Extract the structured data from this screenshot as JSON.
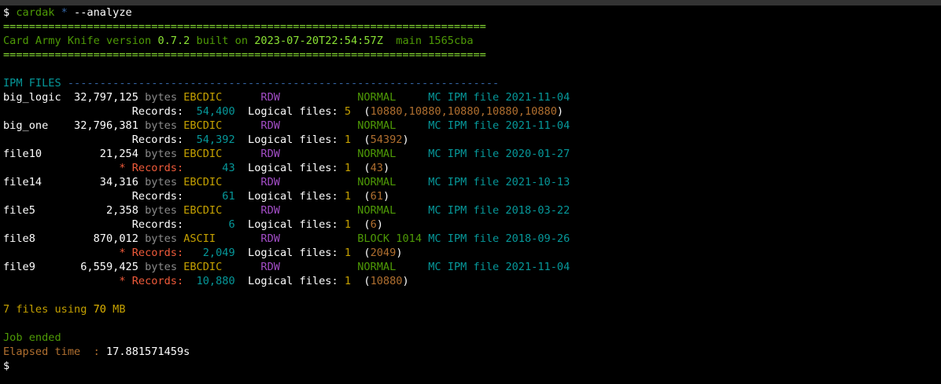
{
  "prompt": {
    "sign": "$",
    "command": "cardak",
    "glob": "*",
    "flag": "--analyze"
  },
  "banner": {
    "rule": "===========================================================================",
    "product": "Card Army Knife",
    "version_label": "version",
    "version": "0.7.2",
    "built_label": "built on",
    "built": "2023-07-20T22:54:57Z",
    "branch": "main",
    "commit": "1565cba"
  },
  "section": {
    "title": "IPM FILES",
    "rule": "-------------------------------------------------------------------"
  },
  "files": [
    {
      "name": "big_logic",
      "size": "32,797,125",
      "encoding": "EBCDIC",
      "format": "RDW",
      "blocking": "NORMAL",
      "type": "MC IPM file",
      "date": "2021-11-04",
      "warn": "",
      "records": "54,400",
      "logical_count": "5",
      "logical_detail": "10880,10880,10880,10880,10880"
    },
    {
      "name": "big_one",
      "size": "32,796,381",
      "encoding": "EBCDIC",
      "format": "RDW",
      "blocking": "NORMAL",
      "type": "MC IPM file",
      "date": "2021-11-04",
      "warn": "",
      "records": "54,392",
      "logical_count": "1",
      "logical_detail": "54392"
    },
    {
      "name": "file10",
      "size": "21,254",
      "encoding": "EBCDIC",
      "format": "RDW",
      "blocking": "NORMAL",
      "type": "MC IPM file",
      "date": "2020-01-27",
      "warn": "*",
      "records": "43",
      "logical_count": "1",
      "logical_detail": "43"
    },
    {
      "name": "file14",
      "size": "34,316",
      "encoding": "EBCDIC",
      "format": "RDW",
      "blocking": "NORMAL",
      "type": "MC IPM file",
      "date": "2021-10-13",
      "warn": "",
      "records": "61",
      "logical_count": "1",
      "logical_detail": "61"
    },
    {
      "name": "file5",
      "size": "2,358",
      "encoding": "EBCDIC",
      "format": "RDW",
      "blocking": "NORMAL",
      "type": "MC IPM file",
      "date": "2018-03-22",
      "warn": "",
      "records": "6",
      "logical_count": "1",
      "logical_detail": "6"
    },
    {
      "name": "file8",
      "size": "870,012",
      "encoding": "ASCII",
      "format": "RDW",
      "blocking": "BLOCK 1014",
      "type": "MC IPM file",
      "date": "2018-09-26",
      "warn": "*",
      "records": "2,049",
      "logical_count": "1",
      "logical_detail": "2049"
    },
    {
      "name": "file9",
      "size": "6,559,425",
      "encoding": "EBCDIC",
      "format": "RDW",
      "blocking": "NORMAL",
      "type": "MC IPM file",
      "date": "2021-11-04",
      "warn": "*",
      "records": "10,880",
      "logical_count": "1",
      "logical_detail": "10880"
    }
  ],
  "labels": {
    "bytes": "bytes",
    "records": "Records:",
    "logical_files": "Logical files:"
  },
  "summary": {
    "count": "7",
    "files_using": "files using",
    "size": "70",
    "unit": "MB"
  },
  "footer": {
    "job_ended": "Job ended",
    "elapsed_label": "Elapsed time  :",
    "elapsed_value": "17.881571459s",
    "prompt_sign": "$"
  },
  "colors": {
    "background": "#000000",
    "green": "#4e9a06",
    "bright_green": "#8ae234",
    "cyan": "#06989a",
    "blue": "#3465a4",
    "orange": "#c4a000",
    "magenta": "#a24dc6",
    "red": "#ef5a3a",
    "brown": "#b06f2f"
  }
}
